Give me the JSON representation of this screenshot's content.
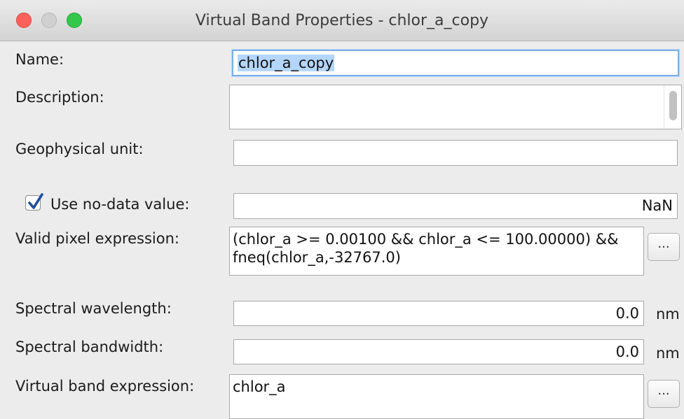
{
  "window": {
    "title": "Virtual Band Properties - chlor_a_copy"
  },
  "form": {
    "name_label": "Name:",
    "name_value": "chlor_a_copy",
    "description_label": "Description:",
    "description_value": "",
    "unit_label": "Geophysical unit:",
    "unit_value": "",
    "nodata_label": "Use no-data value:",
    "nodata_checked": true,
    "nodata_value": "NaN",
    "valid_expr_label": "Valid pixel expression:",
    "valid_expr_value": "(chlor_a >= 0.00100 && chlor_a <= 100.00000) && fneq(chlor_a,-32767.0)",
    "valid_expr_button": "...",
    "wavelength_label": "Spectral wavelength:",
    "wavelength_value": "0.0",
    "wavelength_unit": "nm",
    "bandwidth_label": "Spectral bandwidth:",
    "bandwidth_value": "0.0",
    "bandwidth_unit": "nm",
    "virtual_expr_label": "Virtual band expression:",
    "virtual_expr_value": "chlor_a",
    "virtual_expr_button": "..."
  },
  "icons": {
    "close": "close-traffic-light",
    "minimize": "minimize-traffic-light",
    "zoom": "zoom-traffic-light",
    "checkbox": "checkmark-icon"
  },
  "colors": {
    "close": "#fc605b",
    "minimize": "#d0d0d0",
    "zoom": "#34c84a",
    "selection": "#b4d6fb",
    "focus_ring": "#7aaee8"
  }
}
